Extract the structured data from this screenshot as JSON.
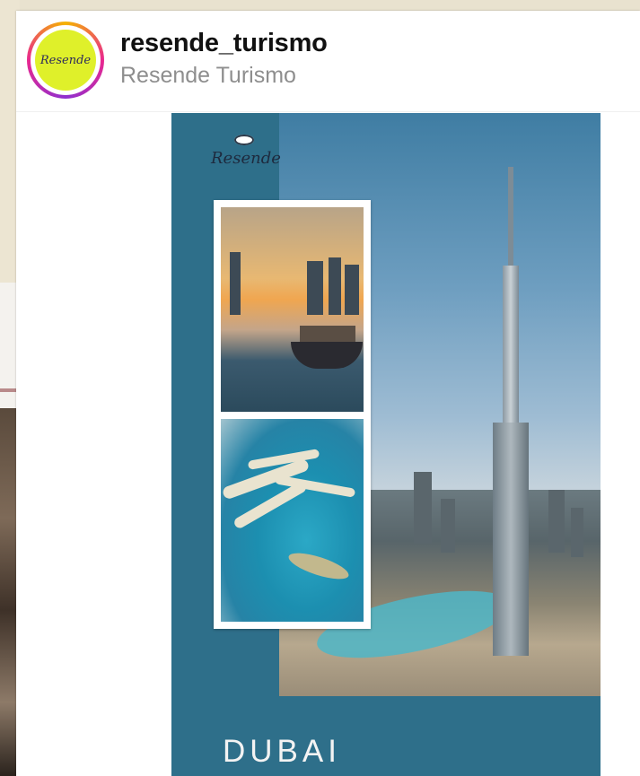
{
  "post": {
    "username": "resende_turismo",
    "display_name": "Resende Turismo",
    "avatar_logo_text": "Resende"
  },
  "poster": {
    "logo_text": "Resende",
    "destination": "DUBAI"
  },
  "colors": {
    "poster_teal": "#2e6f8a",
    "avatar_yellow": "#dff02a",
    "username": "#111111",
    "display_name": "#8e8e8e"
  }
}
